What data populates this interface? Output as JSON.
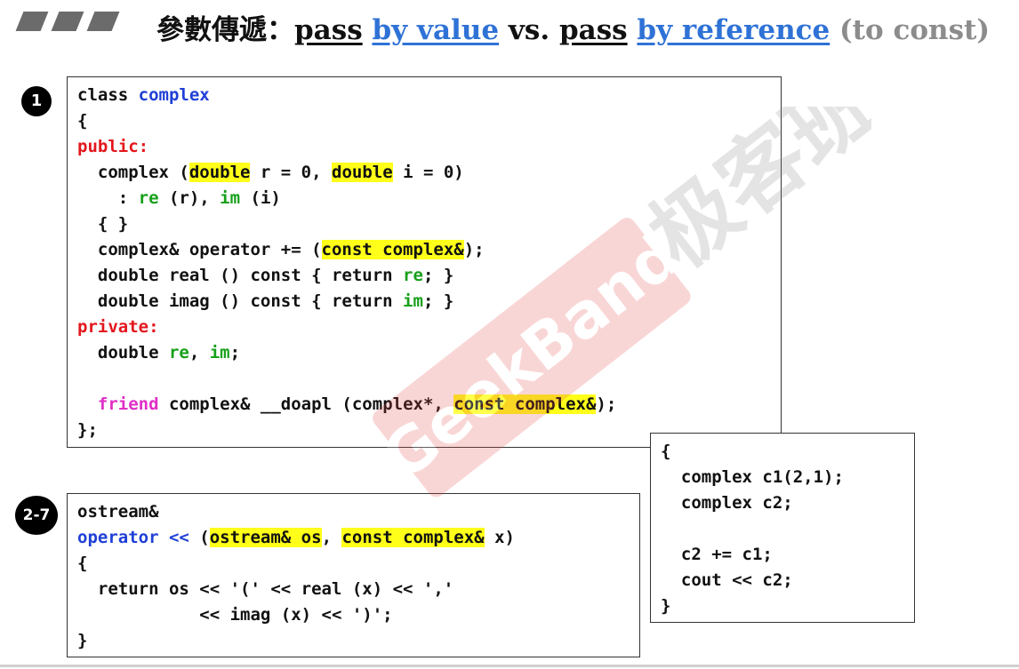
{
  "title": {
    "cjk": "參數傳遞：",
    "pass1": "pass",
    "by_value": "by value",
    "vs": "vs.",
    "pass2": "pass",
    "by_reference": "by reference",
    "to_const": "(to const)"
  },
  "badges": {
    "one": "1",
    "two_seven": "2-7"
  },
  "box1": {
    "l1a": "class ",
    "l1b": "complex",
    "l2": "{",
    "l3": "public:",
    "l4a": "  complex (",
    "l4b": "double",
    "l4c": " r = 0, ",
    "l4d": "double",
    "l4e": " i = 0)",
    "l5a": "    : ",
    "l5b": "re",
    "l5c": " (r), ",
    "l5d": "im",
    "l5e": " (i)",
    "l6": "  { }",
    "l7a": "  complex& operator += (",
    "l7b": "const complex&",
    "l7c": ");",
    "l8a": "  double real () const { return ",
    "l8b": "re",
    "l8c": "; }",
    "l9a": "  double imag () const { return ",
    "l9b": "im",
    "l9c": "; }",
    "l10": "private:",
    "l11a": "  double ",
    "l11b": "re",
    "l11c": ", ",
    "l11d": "im",
    "l11e": ";",
    "l13a": "  ",
    "l13b": "friend",
    "l13c": " complex& __doapl (complex*, ",
    "l13d": "const complex&",
    "l13e": ");",
    "l14": "};"
  },
  "box2": {
    "l1": "ostream&",
    "l2a": "operator <<",
    "l2b": " (",
    "l2c": "ostream& os",
    "l2d": ", ",
    "l2e": "const complex&",
    "l2f": " x)",
    "l3": "{",
    "l4": "  return os << '(' << real (x) << ','",
    "l5": "            << imag (x) << ')';",
    "l6": "}"
  },
  "box3": {
    "l1": "{",
    "l2": "  complex c1(2,1);",
    "l3": "  complex c2;",
    "l5": "  c2 += c1;",
    "l6": "  cout << c2;",
    "l7": "}"
  },
  "watermark": {
    "cjk": "极客班",
    "latin": "GeekBand"
  },
  "colors": {
    "highlight": "#ffff1a",
    "keyword_blue": "#1f3fd6",
    "keyword_red": "#e3171d",
    "member_green": "#17a01a",
    "friend_magenta": "#e02fc6",
    "title_blue": "#2f72d6",
    "watermark_red": "#e84a4a"
  }
}
